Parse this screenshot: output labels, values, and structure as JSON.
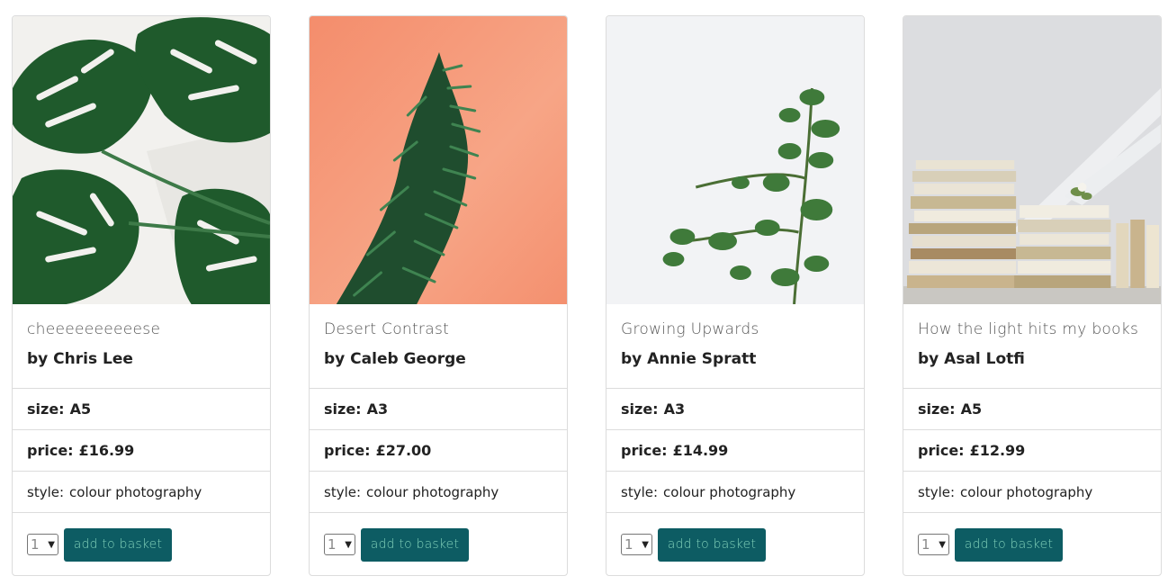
{
  "products": [
    {
      "title": "cheeeeeeeeeese",
      "artist": "by Chris Lee",
      "size_label": "size:",
      "size": "A5",
      "price_label": "price:",
      "price": "£16.99",
      "style_label": "style:",
      "style": "colour photography",
      "qty": "1",
      "button": "add to basket"
    },
    {
      "title": "Desert Contrast",
      "artist": "by Caleb George",
      "size_label": "size:",
      "size": "A3",
      "price_label": "price:",
      "price": "£27.00",
      "style_label": "style:",
      "style": "colour photography",
      "qty": "1",
      "button": "add to basket"
    },
    {
      "title": "Growing Upwards",
      "artist": "by Annie Spratt",
      "size_label": "size:",
      "size": "A3",
      "price_label": "price:",
      "price": "£14.99",
      "style_label": "style:",
      "style": "colour photography",
      "qty": "1",
      "button": "add to basket"
    },
    {
      "title": "How the light hits my books",
      "artist": "by Asal Lotfi",
      "size_label": "size:",
      "size": "A5",
      "price_label": "price:",
      "price": "£12.99",
      "style_label": "style:",
      "style": "colour photography",
      "qty": "1",
      "button": "add to basket"
    }
  ],
  "colors": {
    "button_bg": "#0d5c63",
    "button_text": "#7fcfb8",
    "border": "#dcdcdc"
  }
}
